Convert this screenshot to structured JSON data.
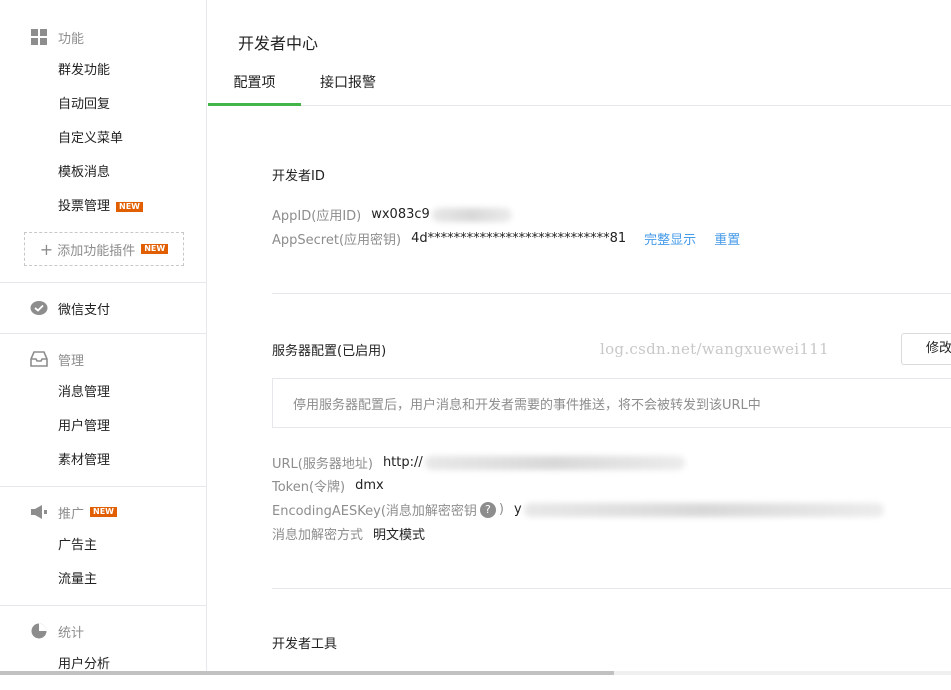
{
  "sidebar": {
    "function": {
      "label": "功能",
      "items": [
        "群发功能",
        "自动回复",
        "自定义菜单",
        "模板消息",
        "投票管理"
      ],
      "new_badge": "NEW",
      "add_plugin_label": "添加功能插件"
    },
    "pay": {
      "label": "微信支付"
    },
    "manage": {
      "label": "管理",
      "items": [
        "消息管理",
        "用户管理",
        "素材管理"
      ]
    },
    "promote": {
      "label": "推广",
      "items": [
        "广告主",
        "流量主"
      ]
    },
    "stats": {
      "label": "统计",
      "items": [
        "用户分析"
      ]
    }
  },
  "main": {
    "title": "开发者中心",
    "tabs": [
      {
        "label": "配置项",
        "active": true
      },
      {
        "label": "接口报警",
        "active": false
      }
    ],
    "developer_id": {
      "title": "开发者ID",
      "appid_label": "AppID(应用ID)",
      "appid_value": "wx083c9",
      "appsecret_label": "AppSecret(应用密钥)",
      "appsecret_value": "4d****************************81",
      "show_full_link": "完整显示",
      "reset_link": "重置"
    },
    "server_config": {
      "title": "服务器配置(已启用)",
      "watermark": "log.csdn.net/wangxuewei111",
      "modify_button": "修改",
      "notice": "停用服务器配置后，用户消息和开发者需要的事件推送，将不会被转发到该URL中",
      "url_label": "URL(服务器地址)",
      "url_value": "http://",
      "token_label": "Token(令牌)",
      "token_value": "dmx",
      "aeskey_label": "EncodingAESKey(消息加解密密钥",
      "aeskey_value": "y",
      "encrypt_label": "消息加解密方式",
      "encrypt_value": "明文模式"
    },
    "dev_tools": {
      "title": "开发者工具"
    }
  },
  "colors": {
    "accent_green": "#44b549",
    "link_blue": "#459ae9",
    "new_badge": "#e15f00"
  }
}
